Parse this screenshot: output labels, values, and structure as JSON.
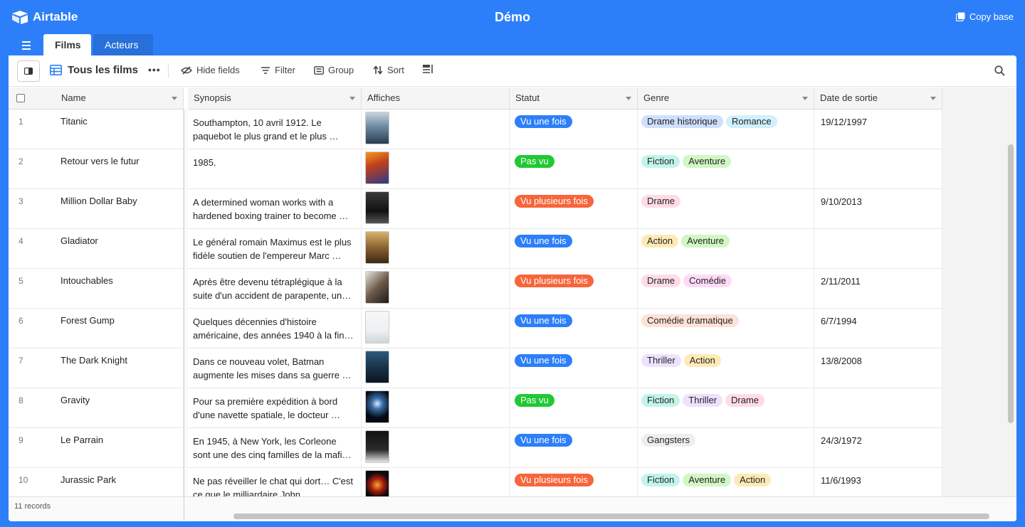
{
  "app": {
    "name": "Airtable",
    "base_title": "Démo",
    "copy_base": "Copy base"
  },
  "tabs": [
    {
      "label": "Films",
      "active": true
    },
    {
      "label": "Acteurs",
      "active": false
    }
  ],
  "view": {
    "name": "Tous les films",
    "more": "•••"
  },
  "toolbar": {
    "hide_fields": "Hide fields",
    "filter": "Filter",
    "group": "Group",
    "sort": "Sort"
  },
  "columns": [
    "Name",
    "Synopsis",
    "Affiches",
    "Statut",
    "Genre",
    "Date de sortie"
  ],
  "colors": {
    "brand": "#2d7ff9",
    "status": {
      "Vu une fois": "#2d7ff9",
      "Pas vu": "#20c933",
      "Vu plusieurs fois": "#f7653b"
    },
    "genre": {
      "Drame historique": "#cfdfff",
      "Romance": "#d0f0fd",
      "Fiction": "#c2f5e9",
      "Aventure": "#d1f7c4",
      "Drame": "#ffdce5",
      "Action": "#ffeab6",
      "Comédie": "#ffdaf6",
      "Comédie dramatique": "#fee2d5",
      "Thriller": "#ede2fe",
      "Gangsters": "#eeeeee"
    }
  },
  "records": [
    {
      "num": "1",
      "name": "Titanic",
      "synopsis": "Southampton, 10 avril 1912. Le paquebot le plus grand et le plus …",
      "statut": "Vu une fois",
      "genres": [
        "Drame historique",
        "Romance"
      ],
      "date": "19/12/1997",
      "poster_icon": "titanic-poster"
    },
    {
      "num": "2",
      "name": "Retour vers le futur",
      "synopsis": " 1985.",
      "statut": "Pas vu",
      "genres": [
        "Fiction",
        "Aventure"
      ],
      "date": "",
      "poster_icon": "back-to-the-future-poster"
    },
    {
      "num": "3",
      "name": "Million Dollar Baby",
      "synopsis": "A determined woman works with a hardened boxing trainer to become …",
      "statut": "Vu plusieurs fois",
      "genres": [
        "Drame"
      ],
      "date": "9/10/2013",
      "poster_icon": "million-dollar-baby-poster"
    },
    {
      "num": "4",
      "name": "Gladiator",
      "synopsis": "Le général romain Maximus est le plus fidèle soutien de l'empereur Marc …",
      "statut": "Vu une fois",
      "genres": [
        "Action",
        "Aventure"
      ],
      "date": "",
      "poster_icon": "gladiator-poster"
    },
    {
      "num": "5",
      "name": "Intouchables",
      "synopsis": "Après être devenu tétraplégique à la suite d'un accident de parapente, un…",
      "statut": "Vu plusieurs fois",
      "genres": [
        "Drame",
        "Comédie"
      ],
      "date": "2/11/2011",
      "poster_icon": "intouchables-poster"
    },
    {
      "num": "6",
      "name": "Forest Gump",
      "synopsis": "Quelques décennies d'histoire américaine, des années 1940 à la fin…",
      "statut": "Vu une fois",
      "genres": [
        "Comédie dramatique"
      ],
      "date": "6/7/1994",
      "poster_icon": "forrest-gump-poster"
    },
    {
      "num": "7",
      "name": "The Dark Knight",
      "synopsis": "Dans ce nouveau volet, Batman augmente les mises dans sa guerre …",
      "statut": "Vu une fois",
      "genres": [
        "Thriller",
        "Action"
      ],
      "date": "13/8/2008",
      "poster_icon": "dark-knight-poster"
    },
    {
      "num": "8",
      "name": "Gravity",
      "synopsis": "Pour sa première expédition à bord d'une navette spatiale, le docteur …",
      "statut": "Pas vu",
      "genres": [
        "Fiction",
        "Thriller",
        "Drame"
      ],
      "date": "",
      "poster_icon": "gravity-poster"
    },
    {
      "num": "9",
      "name": "Le Parrain",
      "synopsis": "En 1945, à New York, les Corleone sont une des cinq familles de la mafi…",
      "statut": "Vu une fois",
      "genres": [
        "Gangsters"
      ],
      "date": "24/3/1972",
      "poster_icon": "godfather-poster"
    },
    {
      "num": "10",
      "name": "Jurassic Park",
      "synopsis": "Ne pas réveiller le chat qui dort… C'est ce que le milliardaire John …",
      "statut": "Vu plusieurs fois",
      "genres": [
        "Fiction",
        "Aventure",
        "Action"
      ],
      "date": "11/6/1993",
      "poster_icon": "jurassic-park-poster"
    }
  ],
  "footer": {
    "record_count": "11 records"
  }
}
